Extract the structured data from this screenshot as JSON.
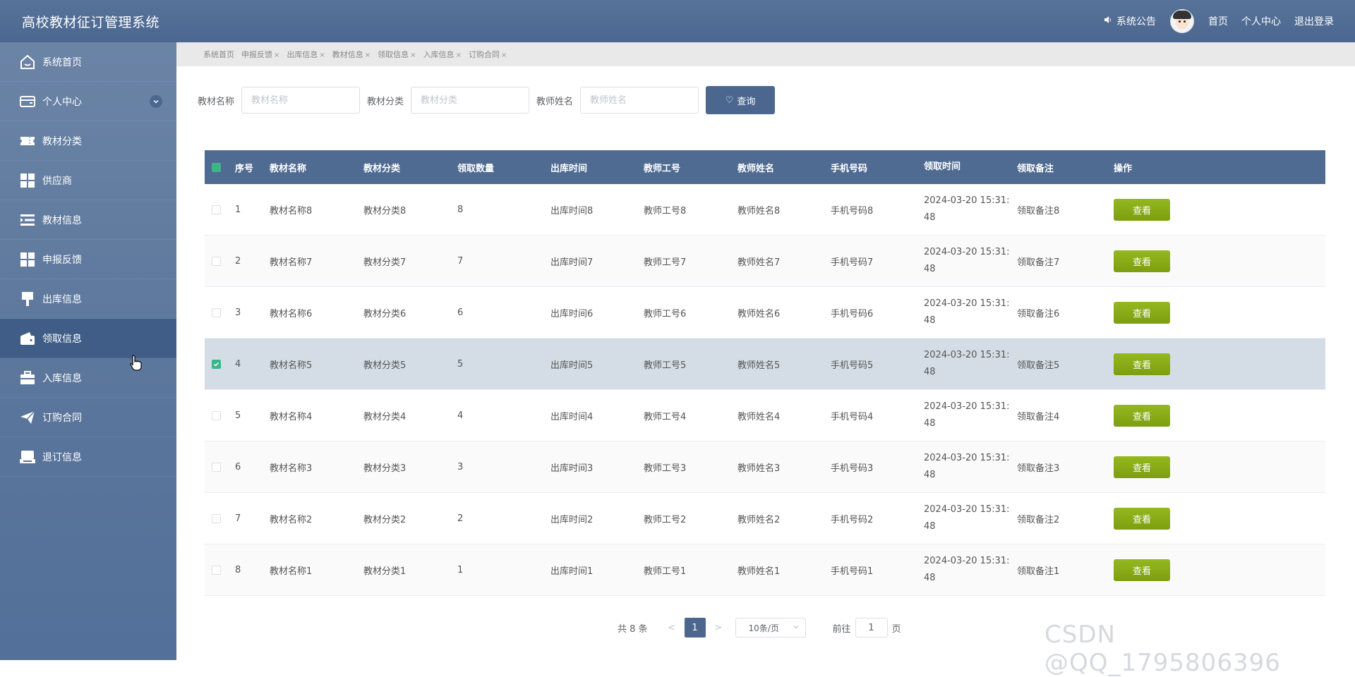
{
  "header": {
    "app_title": "高校教材征订管理系统",
    "notice_label": "系统公告",
    "links": [
      "首页",
      "个人中心",
      "退出登录"
    ]
  },
  "sidebar": {
    "items": [
      {
        "label": "系统首页",
        "icon": "home-icon"
      },
      {
        "label": "个人中心",
        "icon": "card-icon",
        "expandable": true
      },
      {
        "label": "教材分类",
        "icon": "ticket-icon"
      },
      {
        "label": "供应商",
        "icon": "grid-icon"
      },
      {
        "label": "教材信息",
        "icon": "list-icon"
      },
      {
        "label": "申报反馈",
        "icon": "grid-icon"
      },
      {
        "label": "出库信息",
        "icon": "brush-icon"
      },
      {
        "label": "领取信息",
        "icon": "wallet-icon",
        "active": true
      },
      {
        "label": "入库信息",
        "icon": "briefcase-icon"
      },
      {
        "label": "订购合同",
        "icon": "send-icon"
      },
      {
        "label": "退订信息",
        "icon": "inbox-icon"
      }
    ]
  },
  "tabs": [
    {
      "label": "系统首页",
      "closable": false
    },
    {
      "label": "申报反馈",
      "closable": true
    },
    {
      "label": "出库信息",
      "closable": true
    },
    {
      "label": "教材信息",
      "closable": true
    },
    {
      "label": "领取信息",
      "closable": true
    },
    {
      "label": "入库信息",
      "closable": true
    },
    {
      "label": "订购合同",
      "closable": true
    }
  ],
  "tab_close": "×",
  "search": {
    "fields": [
      {
        "label": "教材名称",
        "placeholder": "教材名称"
      },
      {
        "label": "教材分类",
        "placeholder": "教材分类"
      },
      {
        "label": "教师姓名",
        "placeholder": "教师姓名"
      }
    ],
    "button_label": "查询"
  },
  "table": {
    "headers": [
      "序号",
      "教材名称",
      "教材分类",
      "领取数量",
      "出库时间",
      "教师工号",
      "教师姓名",
      "手机号码",
      "领取时间",
      "领取备注",
      "操作"
    ],
    "action_label": "查看",
    "rows": [
      {
        "no": "1",
        "name": "教材名称8",
        "cat": "教材分类8",
        "qty": "8",
        "out": "出库时间8",
        "tid": "教师工号8",
        "tname": "教师姓名8",
        "phone": "手机号码8",
        "time": "2024-03-20 15:31:48",
        "note": "领取备注8",
        "checked": false
      },
      {
        "no": "2",
        "name": "教材名称7",
        "cat": "教材分类7",
        "qty": "7",
        "out": "出库时间7",
        "tid": "教师工号7",
        "tname": "教师姓名7",
        "phone": "手机号码7",
        "time": "2024-03-20 15:31:48",
        "note": "领取备注7",
        "checked": false
      },
      {
        "no": "3",
        "name": "教材名称6",
        "cat": "教材分类6",
        "qty": "6",
        "out": "出库时间6",
        "tid": "教师工号6",
        "tname": "教师姓名6",
        "phone": "手机号码6",
        "time": "2024-03-20 15:31:48",
        "note": "领取备注6",
        "checked": false
      },
      {
        "no": "4",
        "name": "教材名称5",
        "cat": "教材分类5",
        "qty": "5",
        "out": "出库时间5",
        "tid": "教师工号5",
        "tname": "教师姓名5",
        "phone": "手机号码5",
        "time": "2024-03-20 15:31:48",
        "note": "领取备注5",
        "checked": true
      },
      {
        "no": "5",
        "name": "教材名称4",
        "cat": "教材分类4",
        "qty": "4",
        "out": "出库时间4",
        "tid": "教师工号4",
        "tname": "教师姓名4",
        "phone": "手机号码4",
        "time": "2024-03-20 15:31:48",
        "note": "领取备注4",
        "checked": false
      },
      {
        "no": "6",
        "name": "教材名称3",
        "cat": "教材分类3",
        "qty": "3",
        "out": "出库时间3",
        "tid": "教师工号3",
        "tname": "教师姓名3",
        "phone": "手机号码3",
        "time": "2024-03-20 15:31:48",
        "note": "领取备注3",
        "checked": false
      },
      {
        "no": "7",
        "name": "教材名称2",
        "cat": "教材分类2",
        "qty": "2",
        "out": "出库时间2",
        "tid": "教师工号2",
        "tname": "教师姓名2",
        "phone": "手机号码2",
        "time": "2024-03-20 15:31:48",
        "note": "领取备注2",
        "checked": false
      },
      {
        "no": "8",
        "name": "教材名称1",
        "cat": "教材分类1",
        "qty": "1",
        "out": "出库时间1",
        "tid": "教师工号1",
        "tname": "教师姓名1",
        "phone": "手机号码1",
        "time": "2024-03-20 15:31:48",
        "note": "领取备注1",
        "checked": false
      }
    ]
  },
  "pagination": {
    "total_text": "共 8 条",
    "prev": "<",
    "current_page": "1",
    "next": ">",
    "page_size": "10条/页",
    "goto_label": "前往",
    "goto_value": "1",
    "goto_suffix": "页"
  },
  "watermark": "CSDN @QQ_1795806396",
  "colors": {
    "header_bg": "#4f6b92",
    "sidebar_bg": "#5a759b",
    "sidebar_active": "#3f5d86",
    "primary_button": "#4c678f",
    "view_button": "#8aad16",
    "checkbox_on": "#3eb489",
    "selected_row": "#d4dde6"
  }
}
